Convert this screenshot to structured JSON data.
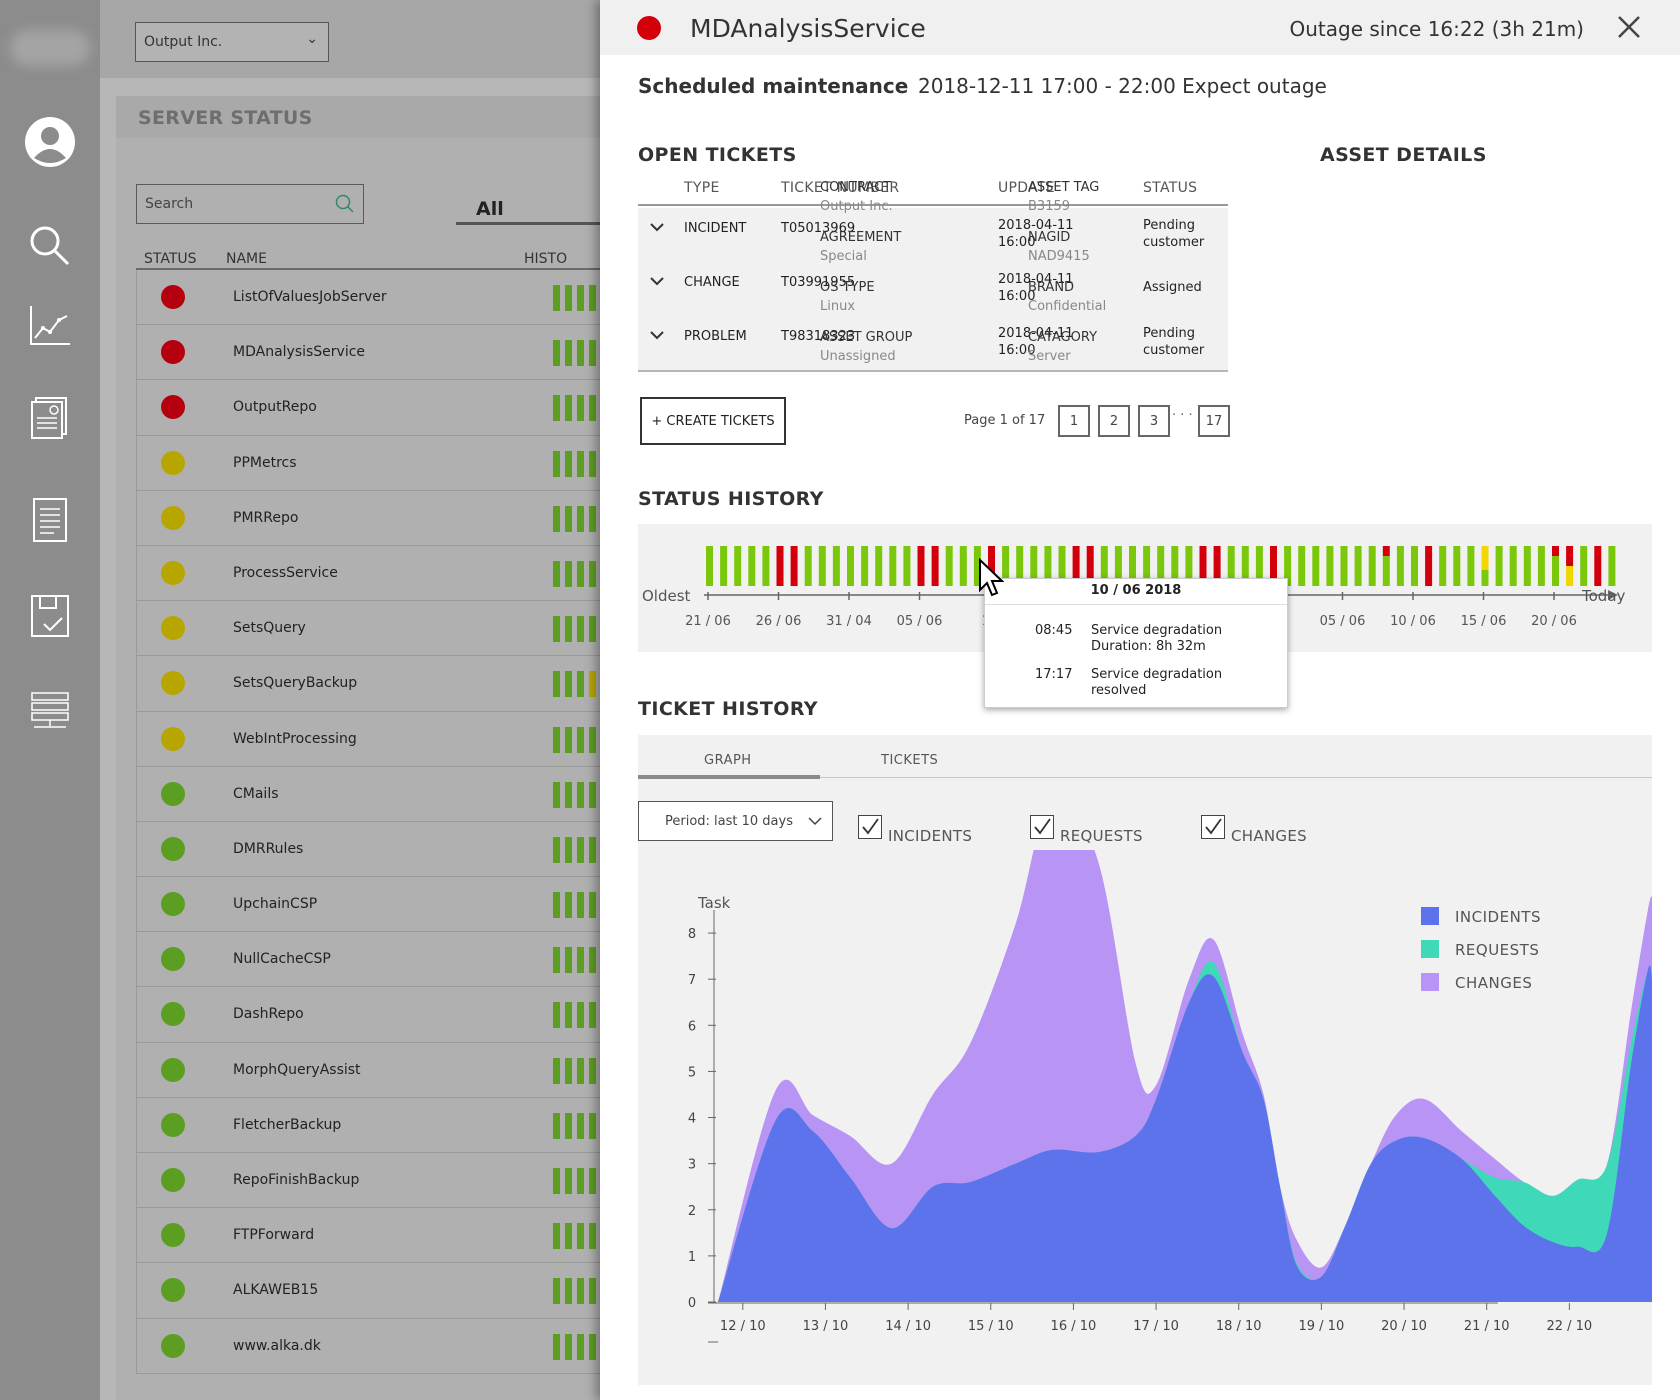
{
  "sidebar": {
    "items": [
      "user-icon",
      "search-icon",
      "chart-icon",
      "report-icon",
      "document-icon",
      "clipboard-icon",
      "server-icon"
    ]
  },
  "company_select": {
    "value": "Output Inc."
  },
  "server_status": {
    "title": "SERVER STATUS",
    "search_placeholder": "Search",
    "filter_tab": "All",
    "columns": {
      "status": "STATUS",
      "name": "NAME",
      "history": "HISTO"
    },
    "rows": [
      {
        "name": "ListOfValuesJobServer",
        "status": "red"
      },
      {
        "name": "MDAnalysisService",
        "status": "red"
      },
      {
        "name": "OutputRepo",
        "status": "red"
      },
      {
        "name": "PPMetrcs",
        "status": "yellow"
      },
      {
        "name": "PMRRepo",
        "status": "yellow"
      },
      {
        "name": "ProcessService",
        "status": "yellow"
      },
      {
        "name": "SetsQuery",
        "status": "yellow"
      },
      {
        "name": "SetsQueryBackup",
        "status": "yellow"
      },
      {
        "name": "WebIntProcessing",
        "status": "yellow"
      },
      {
        "name": "CMails",
        "status": "green"
      },
      {
        "name": "DMRRules",
        "status": "green"
      },
      {
        "name": "UpchainCSP",
        "status": "green"
      },
      {
        "name": "NullCacheCSP",
        "status": "green"
      },
      {
        "name": "DashRepo",
        "status": "green"
      },
      {
        "name": "MorphQueryAssist",
        "status": "green"
      },
      {
        "name": "FletcherBackup",
        "status": "green"
      },
      {
        "name": "RepoFinishBackup",
        "status": "green"
      },
      {
        "name": "FTPForward",
        "status": "green"
      },
      {
        "name": "ALKAWEB15",
        "status": "green"
      },
      {
        "name": "www.alka.dk",
        "status": "green"
      }
    ]
  },
  "colors": {
    "red": "#b4000f",
    "yellow": "#b8a600",
    "green": "#5c9e22",
    "status_red": "#d3000c",
    "status_green": "#7ac70b",
    "status_yellow": "#f2d600",
    "incidents": "#5c73ec",
    "requests": "#3fd8b8",
    "changes": "#b894f5"
  },
  "detail": {
    "title": "MDAnalysisService",
    "status": "red",
    "outage": "Outage since 16:22 (3h 21m)",
    "maintenance_label": "Scheduled maintenance",
    "maintenance_value": "2018-12-11 17:00 - 22:00 Expect outage",
    "open_tickets": {
      "title": "OPEN TICKETS",
      "columns": {
        "type": "TYPE",
        "number": "TICKET NUMBER",
        "update": "UPDATE",
        "status": "STATUS"
      },
      "rows": [
        {
          "type": "INCIDENT",
          "number": "T05013969",
          "update_date": "2018-04-11",
          "update_time": "16:00",
          "status": "Pending customer"
        },
        {
          "type": "CHANGE",
          "number": "T03991955",
          "update_date": "2018-04-11",
          "update_time": "16:00",
          "status": "Assigned"
        },
        {
          "type": "PROBLEM",
          "number": "T98318323",
          "update_date": "2018-04-11",
          "update_time": "16:00",
          "status": "Pending customer"
        }
      ],
      "create_label": "+ CREATE TICKETS",
      "page_info": "Page 1 of 17",
      "pages": [
        "1",
        "2",
        "3",
        "17"
      ],
      "ellipsis": "· · ·"
    },
    "asset_details": {
      "title": "ASSET DETAILS",
      "items": [
        {
          "key": "CONTRACT",
          "value": "Output Inc."
        },
        {
          "key": "ASSET TAG",
          "value": "B3159"
        },
        {
          "key": "AGREEMENT",
          "value": "Special"
        },
        {
          "key": "NAGID",
          "value": "NAD9415"
        },
        {
          "key": "OS TYPE",
          "value": "Linux"
        },
        {
          "key": "BRAND",
          "value": "Confidential"
        },
        {
          "key": "ASSET GROUP",
          "value": "Unassigned"
        },
        {
          "key": "CATAGORY",
          "value": "Server"
        }
      ]
    },
    "status_history": {
      "title": "STATUS HISTORY",
      "oldest_label": "Oldest",
      "today_label": "Today",
      "bars": "GGGGGRRGGGGGGGGRRGGGRGGGGGRRGGGGGGGRRGGGRGGGGGGGMGGRGGGYGGGGMPGRG",
      "ticks": [
        "21 / 06",
        "26 / 06",
        "31 / 04",
        "05 / 06",
        "10",
        "",
        "",
        "",
        "05",
        "05 / 06",
        "10 / 06",
        "15 / 06",
        "20 / 06"
      ],
      "tooltip": {
        "date": "10 / 06 2018",
        "events": [
          {
            "time": "08:45",
            "line1": "Service degradation",
            "line2": "Duration: 8h 32m"
          },
          {
            "time": "17:17",
            "line1": "Service degradation",
            "line2": "resolved"
          }
        ]
      }
    },
    "ticket_history": {
      "title": "TICKET HISTORY",
      "tabs": [
        "GRAPH",
        "TICKETS"
      ],
      "period": "Period: last 10 days",
      "filters": [
        "INCIDENTS",
        "REQUESTS",
        "CHANGES"
      ]
    }
  },
  "chart_data": {
    "type": "area",
    "ylabel": "Task",
    "ylim": [
      0,
      8.5
    ],
    "yticks": [
      0,
      1,
      2,
      3,
      4,
      5,
      6,
      7,
      8
    ],
    "categories": [
      "12 / 10",
      "13 / 10",
      "14 / 10",
      "15 / 10",
      "16 / 10",
      "17 / 10",
      "18 / 10",
      "19 / 10",
      "20 / 10",
      "21 / 10",
      "22 / 10"
    ],
    "x": [
      11.7,
      12.4,
      12.85,
      13.3,
      13.8,
      14.3,
      14.75,
      15.3,
      15.75,
      16.3,
      16.75,
      17.0,
      17.4,
      17.7,
      18.05,
      18.3,
      18.5,
      18.7,
      19.0,
      19.3,
      19.6,
      19.9,
      20.25,
      20.7,
      21.1,
      21.45,
      21.8,
      22.1,
      22.45,
      22.75,
      22.95,
      23.0
    ],
    "series": [
      {
        "name": "INCIDENTS",
        "values": [
          0,
          3.95,
          3.7,
          2.7,
          1.6,
          2.5,
          2.6,
          3.0,
          3.3,
          3.25,
          3.6,
          4.4,
          6.5,
          7.05,
          5.4,
          4.4,
          2.5,
          0.8,
          0.55,
          1.7,
          3.0,
          3.5,
          3.55,
          3.1,
          2.3,
          1.65,
          1.3,
          1.2,
          1.45,
          5.2,
          7.2,
          7.0
        ]
      },
      {
        "name": "REQUESTS",
        "values": [
          0,
          0,
          0,
          0,
          0,
          0,
          0,
          0,
          0,
          0,
          0,
          0,
          0,
          0.3,
          0,
          0,
          0,
          0.05,
          0,
          0,
          0,
          0,
          0,
          0,
          0.4,
          0.95,
          1.0,
          1.45,
          1.5,
          0.45,
          0.0,
          0.0
        ]
      },
      {
        "name": "CHANGES",
        "values": [
          0,
          0.65,
          0.35,
          0.9,
          1.4,
          2.0,
          3.0,
          5.2,
          7.7,
          6.3,
          1.6,
          0.3,
          0.5,
          0.5,
          0.4,
          0.1,
          0,
          0.5,
          0.2,
          0,
          0,
          0.55,
          0.85,
          0.6,
          0.4,
          0,
          0,
          0,
          0,
          0.7,
          1.3,
          1.8
        ]
      }
    ],
    "legend": "top-right",
    "grid": false
  }
}
